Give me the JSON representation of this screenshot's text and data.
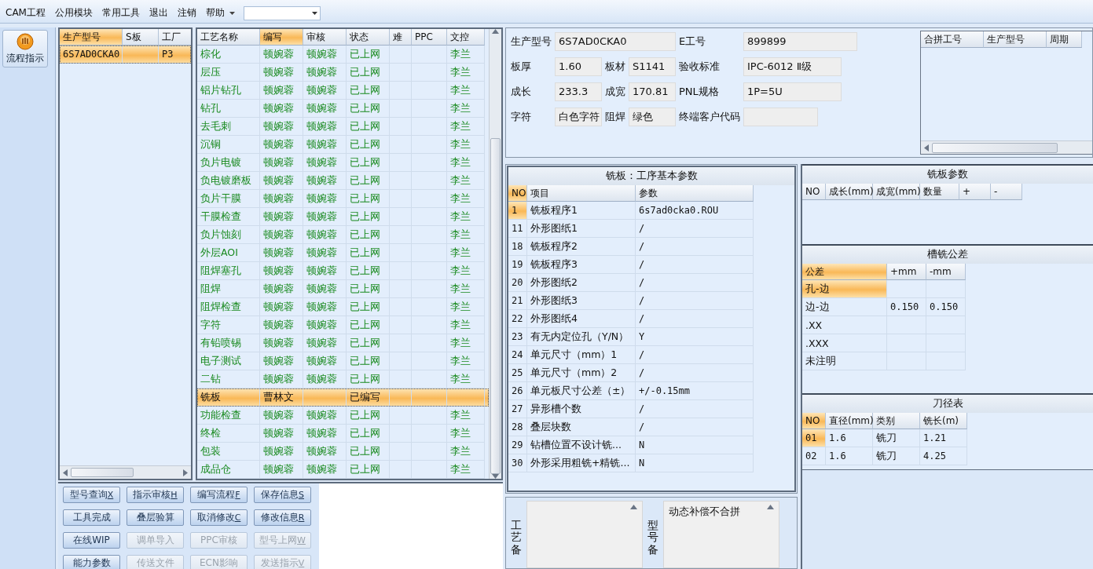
{
  "menu": [
    {
      "label": "CAM工程",
      "has_dropdown": false
    },
    {
      "label": "公用模块",
      "has_dropdown": false
    },
    {
      "label": "常用工具",
      "has_dropdown": false
    },
    {
      "label": "退出",
      "has_dropdown": false
    },
    {
      "label": "注销",
      "has_dropdown": false
    },
    {
      "label": "帮助",
      "has_dropdown": true
    }
  ],
  "side_button": {
    "label": "流程指示"
  },
  "model_list": {
    "columns": [
      {
        "label": "生产型号",
        "selected": true
      },
      {
        "label": "S板",
        "selected": false
      },
      {
        "label": "工厂",
        "selected": false
      }
    ],
    "rows": [
      {
        "cells": [
          "6S7AD0CKA0",
          null,
          "P3"
        ],
        "selected": true
      }
    ]
  },
  "process_table": {
    "columns": [
      {
        "label": "工艺名称",
        "selected": false
      },
      {
        "label": "编写",
        "selected": true
      },
      {
        "label": "审核",
        "selected": false
      },
      {
        "label": "状态",
        "selected": false
      },
      {
        "label": "难",
        "selected": false
      },
      {
        "label": "PPC",
        "selected": false
      },
      {
        "label": "文控",
        "selected": false
      }
    ],
    "rows": [
      {
        "cells": [
          "棕化",
          "顿婉蓉",
          "顿婉蓉",
          "已上网",
          null,
          null,
          "李兰"
        ],
        "selected": false
      },
      {
        "cells": [
          "层压",
          "顿婉蓉",
          "顿婉蓉",
          "已上网",
          null,
          null,
          "李兰"
        ],
        "selected": false
      },
      {
        "cells": [
          "铝片钻孔",
          "顿婉蓉",
          "顿婉蓉",
          "已上网",
          null,
          null,
          "李兰"
        ],
        "selected": false
      },
      {
        "cells": [
          "钻孔",
          "顿婉蓉",
          "顿婉蓉",
          "已上网",
          null,
          null,
          "李兰"
        ],
        "selected": false
      },
      {
        "cells": [
          "去毛刺",
          "顿婉蓉",
          "顿婉蓉",
          "已上网",
          null,
          null,
          "李兰"
        ],
        "selected": false
      },
      {
        "cells": [
          "沉铜",
          "顿婉蓉",
          "顿婉蓉",
          "已上网",
          null,
          null,
          "李兰"
        ],
        "selected": false
      },
      {
        "cells": [
          "负片电镀",
          "顿婉蓉",
          "顿婉蓉",
          "已上网",
          null,
          null,
          "李兰"
        ],
        "selected": false
      },
      {
        "cells": [
          "负电镀磨板",
          "顿婉蓉",
          "顿婉蓉",
          "已上网",
          null,
          null,
          "李兰"
        ],
        "selected": false
      },
      {
        "cells": [
          "负片干膜",
          "顿婉蓉",
          "顿婉蓉",
          "已上网",
          null,
          null,
          "李兰"
        ],
        "selected": false
      },
      {
        "cells": [
          "干膜检查",
          "顿婉蓉",
          "顿婉蓉",
          "已上网",
          null,
          null,
          "李兰"
        ],
        "selected": false
      },
      {
        "cells": [
          "负片蚀刻",
          "顿婉蓉",
          "顿婉蓉",
          "已上网",
          null,
          null,
          "李兰"
        ],
        "selected": false
      },
      {
        "cells": [
          "外层AOI",
          "顿婉蓉",
          "顿婉蓉",
          "已上网",
          null,
          null,
          "李兰"
        ],
        "selected": false
      },
      {
        "cells": [
          "阻焊塞孔",
          "顿婉蓉",
          "顿婉蓉",
          "已上网",
          null,
          null,
          "李兰"
        ],
        "selected": false
      },
      {
        "cells": [
          "阻焊",
          "顿婉蓉",
          "顿婉蓉",
          "已上网",
          null,
          null,
          "李兰"
        ],
        "selected": false
      },
      {
        "cells": [
          "阻焊检查",
          "顿婉蓉",
          "顿婉蓉",
          "已上网",
          null,
          null,
          "李兰"
        ],
        "selected": false
      },
      {
        "cells": [
          "字符",
          "顿婉蓉",
          "顿婉蓉",
          "已上网",
          null,
          null,
          "李兰"
        ],
        "selected": false
      },
      {
        "cells": [
          "有铅喷锡",
          "顿婉蓉",
          "顿婉蓉",
          "已上网",
          null,
          null,
          "李兰"
        ],
        "selected": false
      },
      {
        "cells": [
          "电子测试",
          "顿婉蓉",
          "顿婉蓉",
          "已上网",
          null,
          null,
          "李兰"
        ],
        "selected": false
      },
      {
        "cells": [
          "二钻",
          "顿婉蓉",
          "顿婉蓉",
          "已上网",
          null,
          null,
          "李兰"
        ],
        "selected": false
      },
      {
        "cells": [
          "铣板",
          "曹林文",
          null,
          "已编写",
          null,
          null,
          null
        ],
        "selected": true
      },
      {
        "cells": [
          "功能检查",
          "顿婉蓉",
          "顿婉蓉",
          "已上网",
          null,
          null,
          "李兰"
        ],
        "selected": false
      },
      {
        "cells": [
          "终检",
          "顿婉蓉",
          "顿婉蓉",
          "已上网",
          null,
          null,
          "李兰"
        ],
        "selected": false
      },
      {
        "cells": [
          "包装",
          "顿婉蓉",
          "顿婉蓉",
          "已上网",
          null,
          null,
          "李兰"
        ],
        "selected": false
      },
      {
        "cells": [
          "成品仓",
          "顿婉蓉",
          "顿婉蓉",
          "已上网",
          null,
          null,
          "李兰"
        ],
        "selected": false
      }
    ]
  },
  "actions": [
    {
      "label": "型号查询",
      "shortcut": "X",
      "disabled": false
    },
    {
      "label": "指示审核",
      "shortcut": "H",
      "disabled": false
    },
    {
      "label": "编写流程",
      "shortcut": "F",
      "disabled": false
    },
    {
      "label": "保存信息",
      "shortcut": "S",
      "disabled": false
    },
    {
      "label": "工具完成",
      "disabled": false
    },
    {
      "label": "叠层验算",
      "disabled": false
    },
    {
      "label": "取消修改",
      "shortcut": "C",
      "disabled": false
    },
    {
      "label": "修改信息",
      "shortcut": "R",
      "disabled": false
    },
    {
      "label": "在线WIP",
      "disabled": false
    },
    {
      "label": "调单导入",
      "disabled": true
    },
    {
      "label": "PPC审核",
      "disabled": true
    },
    {
      "label": "型号上网",
      "shortcut": "W",
      "disabled": true
    },
    {
      "label": "能力参数",
      "disabled": false
    },
    {
      "label": "传送文件",
      "disabled": true
    },
    {
      "label": "ECN影响",
      "disabled": true
    },
    {
      "label": "发送指示",
      "shortcut": "V",
      "disabled": true
    }
  ],
  "info": {
    "rows": [
      [
        {
          "label": "生产型号",
          "value": "6S7AD0CKA0"
        },
        null,
        {
          "label": "E工号",
          "value": "899899"
        }
      ],
      [
        {
          "label": "板厚",
          "value": "1.60"
        },
        {
          "label": "板材",
          "value": "S1141"
        },
        {
          "label": "验收标准",
          "value": "IPC-6012 Ⅱ级"
        }
      ],
      [
        {
          "label": "成长",
          "value": "233.3"
        },
        {
          "label": "成宽",
          "value": "170.81"
        },
        {
          "label": "PNL规格",
          "value": "1P=5U"
        }
      ],
      [
        {
          "label": "字符",
          "value": "白色字符"
        },
        {
          "label": "阻焊",
          "value": "绿色"
        },
        {
          "label": "终端客户代码"
        }
      ]
    ]
  },
  "merge_table": {
    "columns": [
      "合拼工号",
      "生产型号",
      "周期"
    ]
  },
  "params_panel": {
    "title": "铣板：工序基本参数",
    "columns": [
      {
        "label": "NO",
        "selected": true
      },
      {
        "label": "项目",
        "selected": false
      },
      {
        "label": "参数",
        "selected": false
      }
    ],
    "rows": [
      {
        "cells": [
          "1",
          "铣板程序1",
          "6s7ad0cka0.ROU"
        ],
        "selected": true
      },
      {
        "cells": [
          "11",
          "外形图纸1",
          "/"
        ],
        "selected": false
      },
      {
        "cells": [
          "18",
          "铣板程序2",
          "/"
        ],
        "selected": false
      },
      {
        "cells": [
          "19",
          "铣板程序3",
          "/"
        ],
        "selected": false
      },
      {
        "cells": [
          "20",
          "外形图纸2",
          "/"
        ],
        "selected": false
      },
      {
        "cells": [
          "21",
          "外形图纸3",
          "/"
        ],
        "selected": false
      },
      {
        "cells": [
          "22",
          "外形图纸4",
          "/"
        ],
        "selected": false
      },
      {
        "cells": [
          "23",
          "有无内定位孔（Y/N）",
          "Y"
        ],
        "selected": false
      },
      {
        "cells": [
          "24",
          "单元尺寸（mm）1",
          "/"
        ],
        "selected": false
      },
      {
        "cells": [
          "25",
          "单元尺寸（mm）2",
          "/"
        ],
        "selected": false
      },
      {
        "cells": [
          "26",
          "单元板尺寸公差（±）",
          "+/-0.15mm"
        ],
        "selected": false
      },
      {
        "cells": [
          "27",
          "异形槽个数",
          "/"
        ],
        "selected": false
      },
      {
        "cells": [
          "28",
          "叠层块数",
          "/"
        ],
        "selected": false
      },
      {
        "cells": [
          "29",
          "钻槽位置不设计铣...",
          "N"
        ],
        "selected": false
      },
      {
        "cells": [
          "30",
          "外形采用粗铣+精铣...",
          "N"
        ],
        "selected": false
      }
    ]
  },
  "remarks": [
    {
      "label": "工艺备"
    },
    {
      "label": "型号备",
      "value": "动态补偿不合拼"
    }
  ],
  "mill_params": {
    "title": "铣板参数",
    "columns": [
      {
        "label": "NO",
        "selected": false
      },
      {
        "label": "成长(mm)",
        "selected": false
      },
      {
        "label": "成宽(mm)",
        "selected": false
      },
      {
        "label": "数量",
        "selected": false
      },
      {
        "label": "+",
        "selected": false
      },
      {
        "label": "-",
        "selected": false
      }
    ]
  },
  "slot_tolerance": {
    "title": "槽铣公差",
    "columns": [
      {
        "label": "公差",
        "selected": true
      },
      {
        "label": "+mm",
        "selected": false
      },
      {
        "label": "-mm",
        "selected": false
      }
    ],
    "rows": [
      {
        "cells": [
          "孔-边",
          null,
          null
        ],
        "selected": true
      },
      {
        "cells": [
          "边-边",
          "0.150",
          "0.150"
        ],
        "selected": false
      },
      {
        "cells": [
          ".XX",
          null,
          null
        ],
        "selected": false
      },
      {
        "cells": [
          ".XXX",
          null,
          null
        ],
        "selected": false
      },
      {
        "cells": [
          "未注明",
          null,
          null
        ],
        "selected": false
      }
    ]
  },
  "tool_table": {
    "title": "刀径表",
    "columns": [
      {
        "label": "NO",
        "selected": true
      },
      {
        "label": "直径(mm)",
        "selected": false
      },
      {
        "label": "类别",
        "selected": false
      },
      {
        "label": "铣长(m)",
        "selected": false
      }
    ],
    "rows": [
      {
        "cells": [
          "01",
          "1.6",
          "铣刀",
          "1.21"
        ],
        "selected": true
      },
      {
        "cells": [
          "02",
          "1.6",
          "铣刀",
          "4.25"
        ],
        "selected": false
      }
    ]
  }
}
